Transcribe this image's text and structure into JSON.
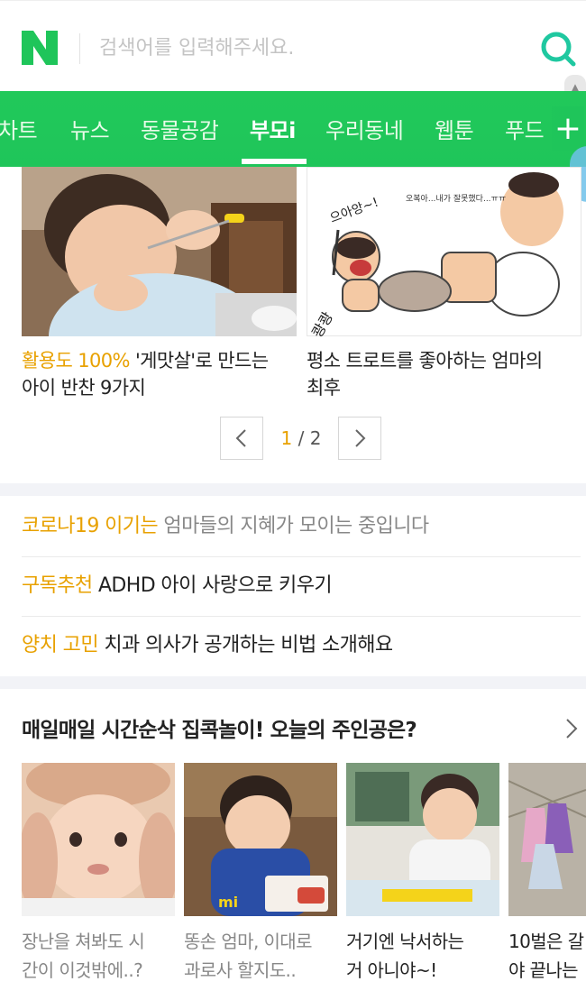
{
  "search": {
    "placeholder": "검색어를 입력해주세요."
  },
  "tabs": [
    "차트",
    "뉴스",
    "동물공감",
    "부모i",
    "우리동네",
    "웹툰",
    "푸드"
  ],
  "active_tab": "부모i",
  "cards": [
    {
      "highlight": "활용도 100%",
      "title_rest": " '게맛살'로 만드는",
      "title_line2": "아이 반찬 9가지"
    },
    {
      "title_line1": "평소 트로트를 좋아하는 엄마의",
      "title_line2": "최후"
    }
  ],
  "pager": {
    "current": "1",
    "separator": "/",
    "total": "2"
  },
  "notices": [
    {
      "tag": "코로나19 이기는",
      "text": " 엄마들의 지혜가 모이는 중입니다"
    },
    {
      "tag": "구독추천",
      "text": " ADHD 아이 사랑으로 키우기"
    },
    {
      "tag": "양치 고민",
      "text": " 치과 의사가 공개하는 비법 소개해요"
    }
  ],
  "section": {
    "title": "매일매일 시간순삭 집콕놀이! 오늘의 주인공은?"
  },
  "thumbs": [
    {
      "line1": "장난을 쳐봐도 시",
      "line2": "간이 이것밖에..?"
    },
    {
      "line1": "똥손 엄마, 이대로",
      "line2": "과로사 할지도.."
    },
    {
      "line1": "거기엔 낙서하는",
      "line2": "거 아니야~!"
    },
    {
      "line1": "10벌은 갈",
      "line2": "야 끝나는"
    }
  ],
  "cartoon_text": {
    "shout": "으아앙~!",
    "sound": "쾅쾅",
    "bubble": "오복아...내가 잘못했다...ㅠㅠ"
  },
  "colors": {
    "brand_green": "#1fc55a",
    "highlight": "#e8a100"
  },
  "icons": {
    "logo": "naver-n-logo",
    "search": "search-icon",
    "plus": "plus-icon"
  }
}
